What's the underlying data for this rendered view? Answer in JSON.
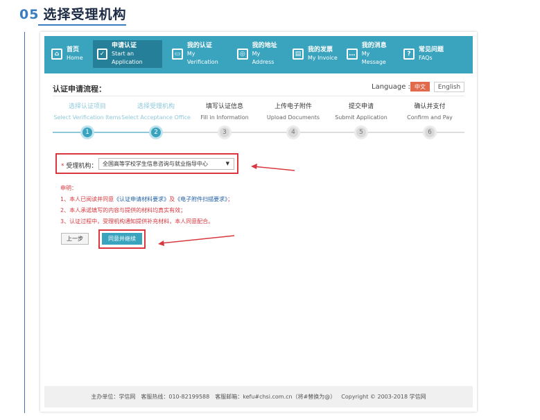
{
  "heading": {
    "number": "05",
    "title": "选择受理机构"
  },
  "nav": {
    "items": [
      {
        "cn": "首页",
        "en": "Home",
        "icon": "home-icon",
        "glyph": "⌂"
      },
      {
        "cn": "申请认证",
        "en": "Start an Application",
        "icon": "check-icon",
        "glyph": "✓"
      },
      {
        "cn": "我的认证",
        "en": "My Verification",
        "icon": "certificate-icon",
        "glyph": "▭"
      },
      {
        "cn": "我的地址",
        "en": "My Address",
        "icon": "location-icon",
        "glyph": "◎"
      },
      {
        "cn": "我的发票",
        "en": "My Invoice",
        "icon": "invoice-icon",
        "glyph": "▤"
      },
      {
        "cn": "我的消息",
        "en": "My Message",
        "icon": "message-icon",
        "glyph": "…"
      },
      {
        "cn": "常见问题",
        "en": "FAQs",
        "icon": "question-icon",
        "glyph": "?"
      }
    ],
    "active_index": 1
  },
  "process": {
    "title": "认证申请流程："
  },
  "language": {
    "label": "Language :",
    "cn": "中文",
    "en": "English"
  },
  "steps": [
    {
      "cn": "选择认证项目",
      "en": "Select Verification Items",
      "num": "1",
      "done": true
    },
    {
      "cn": "选择受理机构",
      "en": "Select Acceptance Office",
      "num": "2",
      "done": true
    },
    {
      "cn": "填写认证信息",
      "en": "Fill in Information",
      "num": "3",
      "done": false
    },
    {
      "cn": "上传电子附件",
      "en": "Upload Documents",
      "num": "4",
      "done": false
    },
    {
      "cn": "提交申请",
      "en": "Submit Application",
      "num": "5",
      "done": false
    },
    {
      "cn": "确认并支付",
      "en": "Confirm and Pay",
      "num": "6",
      "done": false
    }
  ],
  "form": {
    "required_mark": "*",
    "agency_label": "受理机构：",
    "agency_value": "全国高等学校学生信息咨询与就业指导中心",
    "caret": "▼"
  },
  "notice": {
    "title": "申明：",
    "line1_prefix": "1、本人已阅读并同意",
    "line1_link1": "《认证申请材料要求》",
    "line1_mid": "及",
    "line1_link2": "《电子附件扫描要求》",
    "line1_suffix": "；",
    "line2": "2、本人承诺填写的内容与提供的材料均真实有效；",
    "line3": "3、认证过程中，受理机构通知提供补充材料，本人同意配合。"
  },
  "buttons": {
    "back": "上一步",
    "agree": "同意并继续"
  },
  "footer": {
    "host": "主办单位：学信网",
    "hotline": "客服热线：010-82199588",
    "email": "客服邮箱：kefu#chsi.com.cn（将#替换为@）",
    "copyright": "Copyright © 2003-2018 学信网"
  },
  "colors": {
    "accent": "#3aa3be",
    "active": "#257f98",
    "highlight": "#d9363e",
    "heading": "#3b7bbf"
  }
}
